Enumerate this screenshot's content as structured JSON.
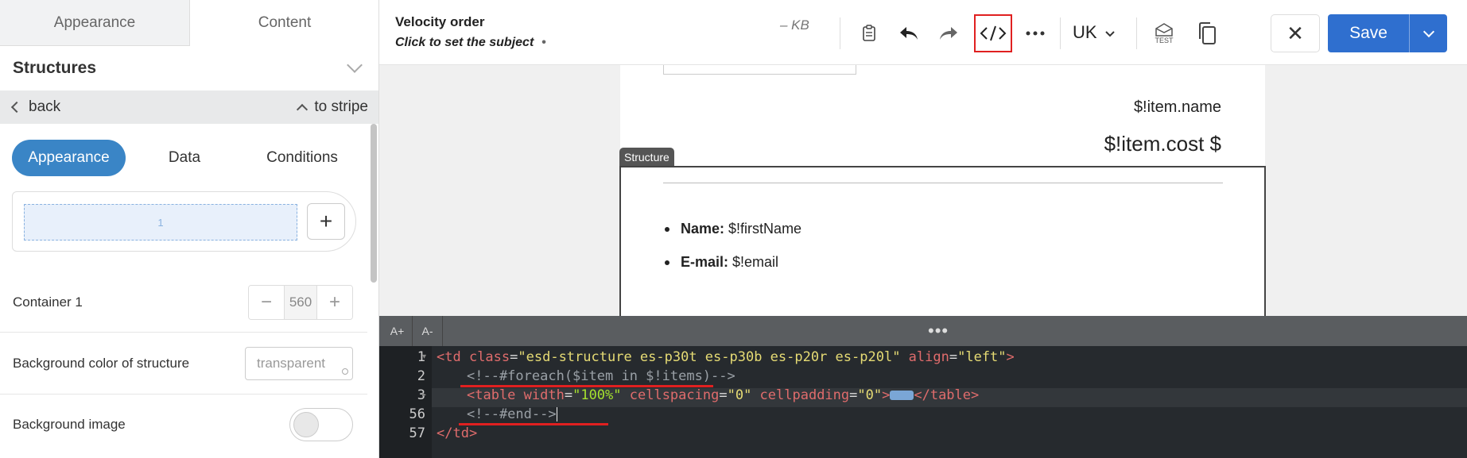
{
  "left_panel": {
    "tabs": {
      "appearance": "Appearance",
      "content": "Content"
    },
    "section_title": "Structures",
    "nav": {
      "back": "back",
      "to_stripe": "to stripe"
    },
    "segments": {
      "appearance": "Appearance",
      "data": "Data",
      "conditions": "Conditions"
    },
    "column_label": "1",
    "add_column": "+",
    "container": {
      "label": "Container 1",
      "value": "560",
      "minus": "−",
      "plus": "+"
    },
    "bg_color": {
      "label": "Background color of structure",
      "value": "transparent"
    },
    "bg_image": {
      "label": "Background image",
      "enabled": false
    }
  },
  "toolbar": {
    "title": "Velocity order",
    "subject": "Click to set the subject",
    "subject_dot": "•",
    "size": "– KB",
    "language": "UK",
    "test_label": "TEST",
    "close": "✕",
    "save": "Save",
    "icons": [
      "clipboard-icon",
      "undo-icon",
      "redo-icon",
      "code-icon",
      "more-icon",
      "chevron-down-icon",
      "test-icon",
      "copy-icon"
    ]
  },
  "canvas": {
    "item_name": "$!item.name",
    "item_cost": "$!item.cost $",
    "structure_tag": "Structure",
    "fields": [
      {
        "label": "Name:",
        "value": "$!firstName"
      },
      {
        "label": "E-mail:",
        "value": "$!email"
      }
    ]
  },
  "editor": {
    "font_up": "A+",
    "font_down": "A-",
    "handle": "•••",
    "line_numbers": [
      "1",
      "2",
      "3",
      "56",
      "57"
    ],
    "lines": {
      "l1": {
        "open": "<td",
        "attr_class": " class",
        "eq1": "=",
        "class_val": "\"esd-structure es-p30t es-p30b es-p20r es-p20l\"",
        "attr_align": " align",
        "eq2": "=",
        "align_val": "\"left\"",
        "close": ">"
      },
      "l2": "<!--#foreach($item in $!items)-->",
      "l3": {
        "open": "<table",
        "attr_width": " width",
        "eq1": "=",
        "width_val": "\"100%\"",
        "attr_cs": " cellspacing",
        "eq2": "=",
        "cs_val": "\"0\"",
        "attr_cp": " cellpadding",
        "eq3": "=",
        "cp_val": "\"0\"",
        "gt": ">",
        "close": "</table>"
      },
      "l56": "<!--#end-->",
      "l57": "</td>"
    }
  },
  "colors": {
    "accent": "#2f6fcf",
    "pill": "#3a85c6",
    "highlight": "#e02020",
    "editor_bg": "#262a2e"
  }
}
